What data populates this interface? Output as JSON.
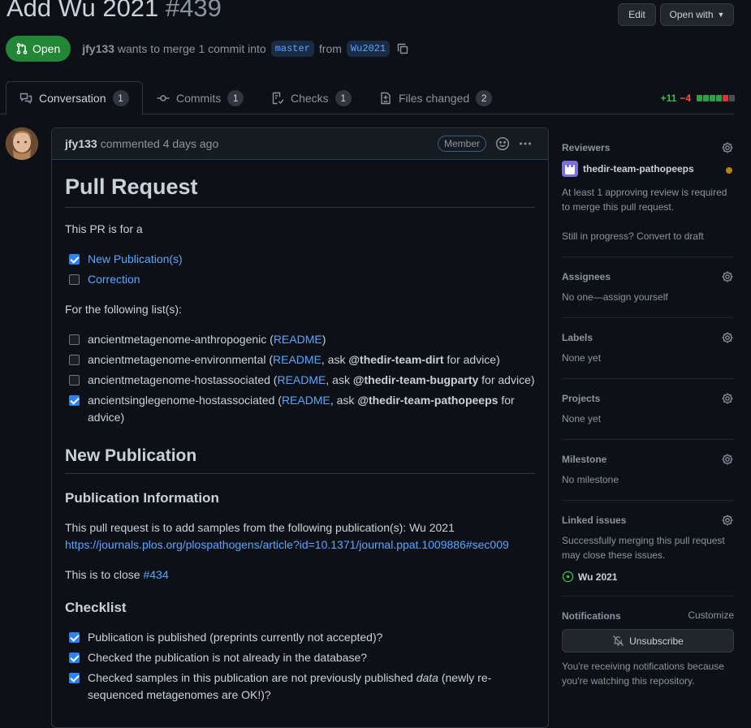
{
  "header": {
    "title": "Add Wu 2021",
    "number": "#439",
    "edit_label": "Edit",
    "open_with_label": "Open with"
  },
  "pr_state": {
    "badge": "Open",
    "author": "jfy133",
    "merge_text": "wants to merge 1 commit into",
    "base_branch": "master",
    "from_text": "from",
    "head_branch": "Wu2021"
  },
  "tabs": [
    {
      "label": "Conversation",
      "count": "1",
      "icon": "comment-discussion-icon"
    },
    {
      "label": "Commits",
      "count": "1",
      "icon": "commit-icon"
    },
    {
      "label": "Checks",
      "count": "1",
      "icon": "checklist-icon"
    },
    {
      "label": "Files changed",
      "count": "2",
      "icon": "file-diff-icon"
    }
  ],
  "diffstat": {
    "additions": "+11",
    "deletions": "−4",
    "blocks": [
      "#2ea043",
      "#2ea043",
      "#2ea043",
      "#2ea043",
      "#da3633",
      "#484f58"
    ]
  },
  "comment": {
    "author": "jfy133",
    "meta": "commented 4 days ago",
    "badge": "Member",
    "h1": "Pull Request",
    "intro": "This PR is for a",
    "type_tasks": [
      {
        "checked": true,
        "text": "New Publication(s)"
      },
      {
        "checked": false,
        "text": "Correction"
      }
    ],
    "lists_intro": "For the following list(s):",
    "list_tasks": [
      {
        "checked": false,
        "name": "ancientmetagenome-anthropogenic (",
        "readme": "README",
        "ask": "",
        "team": "",
        "tail": ")"
      },
      {
        "checked": false,
        "name": "ancientmetagenome-environmental (",
        "readme": "README",
        "ask": ", ask ",
        "team": "@thedir-team-dirt",
        "tail": " for advice)"
      },
      {
        "checked": false,
        "name": "ancientmetagenome-hostassociated (",
        "readme": "README",
        "ask": ", ask ",
        "team": "@thedir-team-bugparty",
        "tail": " for advice)"
      },
      {
        "checked": true,
        "name": "ancientsinglegenome-hostassociated (",
        "readme": "README",
        "ask": ", ask ",
        "team": "@thedir-team-pathopeeps",
        "tail": " for advice)"
      }
    ],
    "h2_new_pub": "New Publication",
    "h3_pub_info": "Publication Information",
    "pub_info_text": "This pull request is to add samples from the following publication(s): Wu 2021",
    "pub_link": "https://journals.plos.org/plospathogens/article?id=10.1371/journal.ppat.1009886#sec009",
    "close_text": "This is to close ",
    "close_link": "#434",
    "h3_checklist": "Checklist",
    "checklist": [
      {
        "checked": true,
        "text": "Publication is published (preprints currently not accepted)?"
      },
      {
        "checked": true,
        "text": "Checked the publication is not already in the database?"
      },
      {
        "checked": true,
        "pre": "Checked samples in this publication are not previously published ",
        "em": "data",
        "post": " (newly re-sequenced metagenomes are OK!)?"
      }
    ]
  },
  "sidebar": {
    "reviewers_title": "Reviewers",
    "reviewer_name": "thedir-team-pathopeeps",
    "reviewers_note": "At least 1 approving review is required to merge this pull request.",
    "draft_note": "Still in progress? Convert to draft",
    "assignees_title": "Assignees",
    "assignees_value": "No one—assign yourself",
    "labels_title": "Labels",
    "labels_value": "None yet",
    "projects_title": "Projects",
    "projects_value": "None yet",
    "milestone_title": "Milestone",
    "milestone_value": "No milestone",
    "linked_title": "Linked issues",
    "linked_note": "Successfully merging this pull request may close these issues.",
    "linked_issue": "Wu 2021",
    "notifications_title": "Notifications",
    "customize_label": "Customize",
    "unsubscribe_label": "Unsubscribe",
    "notifications_note": "You're receiving notifications because you're watching this repository."
  }
}
